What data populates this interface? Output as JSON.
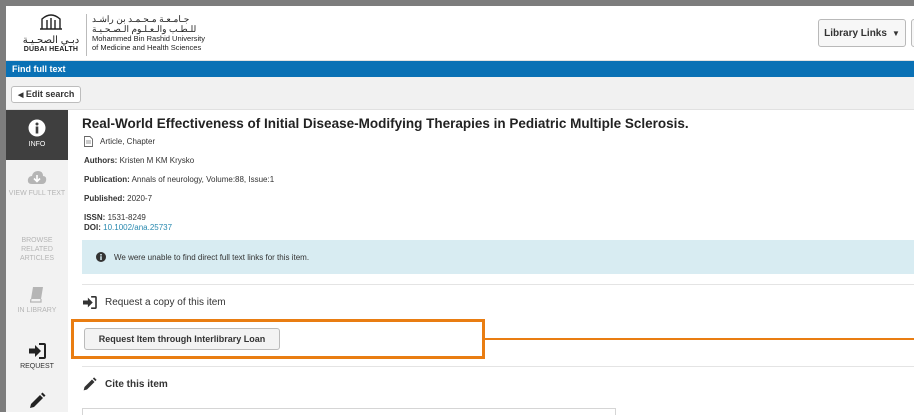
{
  "header": {
    "dh_logo_ar": "دبـي الصحـيـة",
    "dh_logo_en": "DUBAI HEALTH",
    "uni_ar_line1": "جـامـعـة مـحـمـد بن راشـد",
    "uni_ar_line2": "للـطـب والـعـلـوم الـصـحـيـة",
    "uni_en_line1": "Mohammed Bin Rashid University",
    "uni_en_line2": "of Medicine and Health Sciences",
    "library_links": "Library Links"
  },
  "bluebar": {
    "label": "Find full text"
  },
  "edit_search": {
    "label": "Edit search"
  },
  "sidebar": {
    "items": [
      {
        "label": "INFO"
      },
      {
        "label": "VIEW FULL TEXT"
      },
      {
        "label": "BROWSE RELATED ARTICLES"
      },
      {
        "label": "IN LIBRARY"
      },
      {
        "label": "REQUEST"
      }
    ]
  },
  "item": {
    "title": "Real-World Effectiveness of Initial Disease-Modifying Therapies in Pediatric Multiple Sclerosis.",
    "type": "Article, Chapter",
    "authors_label": "Authors:",
    "authors": "Kristen M KM Krysko",
    "publication_label": "Publication:",
    "publication": "Annals of neurology, Volume:88, Issue:1",
    "published_label": "Published:",
    "published": "2020-7",
    "issn_label": "ISSN:",
    "issn": "1531-8249",
    "doi_label": "DOI:",
    "doi": "10.1002/ana.25737"
  },
  "alert": {
    "text": "We were unable to find direct full text links for this item."
  },
  "request": {
    "section_title": "Request a copy of this item",
    "ill_button": "Request Item through Interlibrary Loan"
  },
  "cite": {
    "section_title": "Cite this item"
  },
  "colors": {
    "brand_blue": "#0a71b5",
    "highlight_orange": "#e97d12",
    "alert_bg": "#d8ecf2"
  }
}
